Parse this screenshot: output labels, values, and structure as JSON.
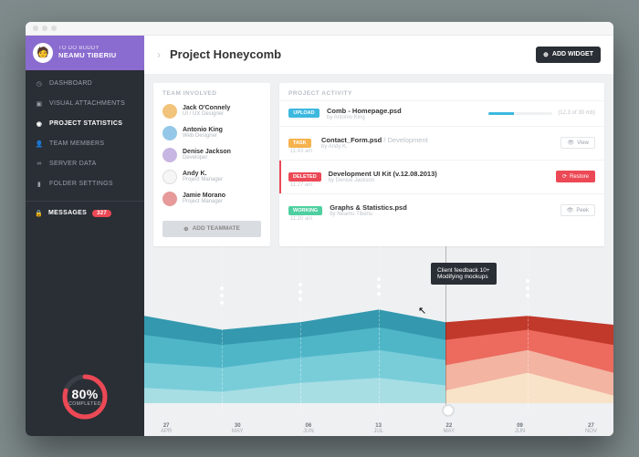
{
  "user": {
    "line1": "TO DO BUDDY",
    "line2": "NEAMU TIBERIU"
  },
  "nav": {
    "dashboard": "DASHBOARD",
    "visual": "VISUAL ATTACHMENTS",
    "stats": "PROJECT STATISTICS",
    "members": "TEAM MEMBERS",
    "server": "SERVER DATA",
    "folder": "FOLDER SETTINGS"
  },
  "messages": {
    "label": "MESSAGES",
    "count": "327"
  },
  "progress": {
    "pct": "80%",
    "label": "COMPLETED",
    "value": 80
  },
  "header": {
    "title": "Project Honeycomb",
    "addWidget": "ADD WIDGET"
  },
  "team": {
    "heading": "TEAM INVOLVED",
    "members": [
      {
        "name": "Jack O'Connely",
        "role": "UI / UX Designer"
      },
      {
        "name": "Antonio King",
        "role": "Web Designer"
      },
      {
        "name": "Denise Jackson",
        "role": "Developer"
      },
      {
        "name": "Andy K.",
        "role": "Project Manager"
      },
      {
        "name": "Jamie Morano",
        "role": "Project Manager"
      }
    ],
    "add": "ADD TEAMMATE"
  },
  "activity": {
    "heading": "PROJECT ACTIVITY",
    "items": [
      {
        "tag": "UPLOAD",
        "title": "Comb - Homepage.psd",
        "by": "by Antonio King",
        "progress": 40,
        "size": "(12,3 of 30 mb)"
      },
      {
        "tag": "TASK",
        "time": "11:43 am",
        "title": "Contact_Form.psd",
        "suffix": " / Development",
        "by": "by Andy K.",
        "action": "View"
      },
      {
        "tag": "DELETED",
        "time": "11:27 am",
        "title": "Development UI Kit (v.12.08.2013)",
        "by": "by Denise Jackson",
        "action": "Restore"
      },
      {
        "tag": "WORKING",
        "time": "11:20 am",
        "title": "Graphs & Statistics.psd",
        "by": "by Neamu Tiberiu",
        "action": "Peek"
      }
    ]
  },
  "chart_data": {
    "type": "area",
    "xlabel": "",
    "ylabel": "",
    "categories": [
      {
        "d": "27",
        "m": "APR"
      },
      {
        "d": "30",
        "m": "MAY"
      },
      {
        "d": "06",
        "m": "JUN"
      },
      {
        "d": "13",
        "m": "JUL"
      },
      {
        "d": "22",
        "m": "MAY"
      },
      {
        "d": "09",
        "m": "JUN"
      },
      {
        "d": "27",
        "m": "NOV"
      }
    ],
    "ylim": [
      0,
      100
    ],
    "annotation": "Client feedback 10+\nModifying mockups",
    "annotation_x_index": 4,
    "split_index": 4,
    "series_left": [
      {
        "name": "layer1",
        "color": "#3498ae",
        "values": [
          70,
          60,
          65,
          72,
          60
        ]
      },
      {
        "name": "layer2",
        "color": "#4fb6c8",
        "values": [
          55,
          48,
          52,
          58,
          50
        ]
      },
      {
        "name": "layer3",
        "color": "#79cdd9",
        "values": [
          38,
          35,
          40,
          44,
          40
        ]
      },
      {
        "name": "layer4",
        "color": "#a7dee4",
        "values": [
          22,
          20,
          25,
          28,
          24
        ]
      }
    ],
    "series_right": [
      {
        "name": "layer1",
        "color": "#c0392b",
        "values": [
          60,
          65,
          58
        ]
      },
      {
        "name": "layer2",
        "color": "#ec6a5e",
        "values": [
          48,
          56,
          46
        ]
      },
      {
        "name": "layer3",
        "color": "#f3b4a2",
        "values": [
          34,
          44,
          30
        ]
      },
      {
        "name": "layer4",
        "color": "#f9e3c8",
        "values": [
          20,
          30,
          18
        ]
      }
    ]
  }
}
